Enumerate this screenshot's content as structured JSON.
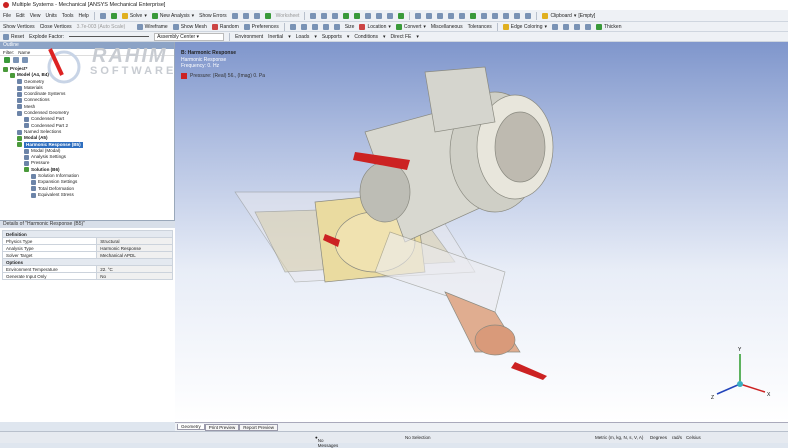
{
  "window": {
    "title": "Multiple Systems - Mechanical [ANSYS Mechanical Enterprise]"
  },
  "menu": [
    "File",
    "Edit",
    "View",
    "Units",
    "Tools",
    "Help"
  ],
  "toolbar1": {
    "solve": "Solve",
    "new_analysis": "New Analysis",
    "show_errors": "Show Errors",
    "worksheet": "Worksheet",
    "clipboard": "Clipboard",
    "clipboard_value": "[Empty]"
  },
  "toolbar2": {
    "show_vertices": "Show Vertices",
    "close_vertices": "Close Vertices",
    "scale": "3.7e-003 (Auto Scale)",
    "wireframe": "Wireframe",
    "show_mesh": "Show Mesh",
    "random": "Random",
    "preferences": "Preferences",
    "size": "Size",
    "location": "Location",
    "convert": "Convert",
    "miscellaneous": "Miscellaneous",
    "tolerances": "Tolerances",
    "edge_coloring": "Edge Coloring",
    "thicken": "Thicken"
  },
  "toolbar3": {
    "reset": "Reset",
    "explode_factor": "Explode Factor:",
    "assembly_center": "Assembly Center",
    "environment": "Environment",
    "inertial": "Inertial",
    "loads": "Loads",
    "supports": "Supports",
    "conditions": "Conditions",
    "direct_fe": "Direct FE"
  },
  "outline": {
    "title": "Outline",
    "filter_label": "Filter:",
    "filter_value": "Name",
    "nodes": [
      {
        "label": "Project*",
        "depth": 0,
        "bold": true
      },
      {
        "label": "Model (A4, B4)",
        "depth": 1,
        "bold": true
      },
      {
        "label": "Geometry",
        "depth": 2
      },
      {
        "label": "Materials",
        "depth": 2
      },
      {
        "label": "Coordinate Systems",
        "depth": 2
      },
      {
        "label": "Connections",
        "depth": 2
      },
      {
        "label": "Mesh",
        "depth": 2
      },
      {
        "label": "Condensed Geometry",
        "depth": 2
      },
      {
        "label": "Condensed Part",
        "depth": 3
      },
      {
        "label": "Condensed Part 2",
        "depth": 3
      },
      {
        "label": "Named Selections",
        "depth": 2
      },
      {
        "label": "Modal (A5)",
        "depth": 2,
        "bold": true
      },
      {
        "label": "Harmonic Response (B5)",
        "depth": 2,
        "bold": true,
        "selected": true
      },
      {
        "label": "Modal (Modal)",
        "depth": 3
      },
      {
        "label": "Analysis Settings",
        "depth": 3
      },
      {
        "label": "Pressure",
        "depth": 3
      },
      {
        "label": "Solution (B6)",
        "depth": 3,
        "bold": true
      },
      {
        "label": "Solution Information",
        "depth": 4
      },
      {
        "label": "Expansion Settings",
        "depth": 4
      },
      {
        "label": "Total Deformation",
        "depth": 4
      },
      {
        "label": "Equivalent Stress",
        "depth": 4
      }
    ]
  },
  "details": {
    "title": "Details of \"Harmonic Response (B5)\"",
    "rows": [
      {
        "group": "Definition"
      },
      {
        "k": "Physics Type",
        "v": "Structural"
      },
      {
        "k": "Analysis Type",
        "v": "Harmonic Response"
      },
      {
        "k": "Solver Target",
        "v": "Mechanical APDL"
      },
      {
        "group": "Options"
      },
      {
        "k": "Environment Temperature",
        "v": "22. °C"
      },
      {
        "k": "Generate Input Only",
        "v": "No"
      }
    ]
  },
  "viewport": {
    "title": "B: Harmonic Response",
    "subtitle": "Harmonic Response",
    "frequency": "Frequency: 0. Hz",
    "legend": "Pressure: (Real) 56., (Imag) 0. Pa",
    "legend_color": "#cc2222",
    "axis_labels": [
      "Y",
      "X",
      "Z"
    ]
  },
  "tabs": [
    "Geometry",
    "Print Preview",
    "Report Preview"
  ],
  "status": {
    "messages": "No Messages",
    "selection": "No Selection",
    "units": "Metric (m, kg, N, s, V, A)",
    "angle": "Degrees",
    "rate": "rad/s",
    "temp": "Celsius"
  },
  "watermark": {
    "line1": "RAHIM",
    "line2": "SOFTWARE"
  }
}
